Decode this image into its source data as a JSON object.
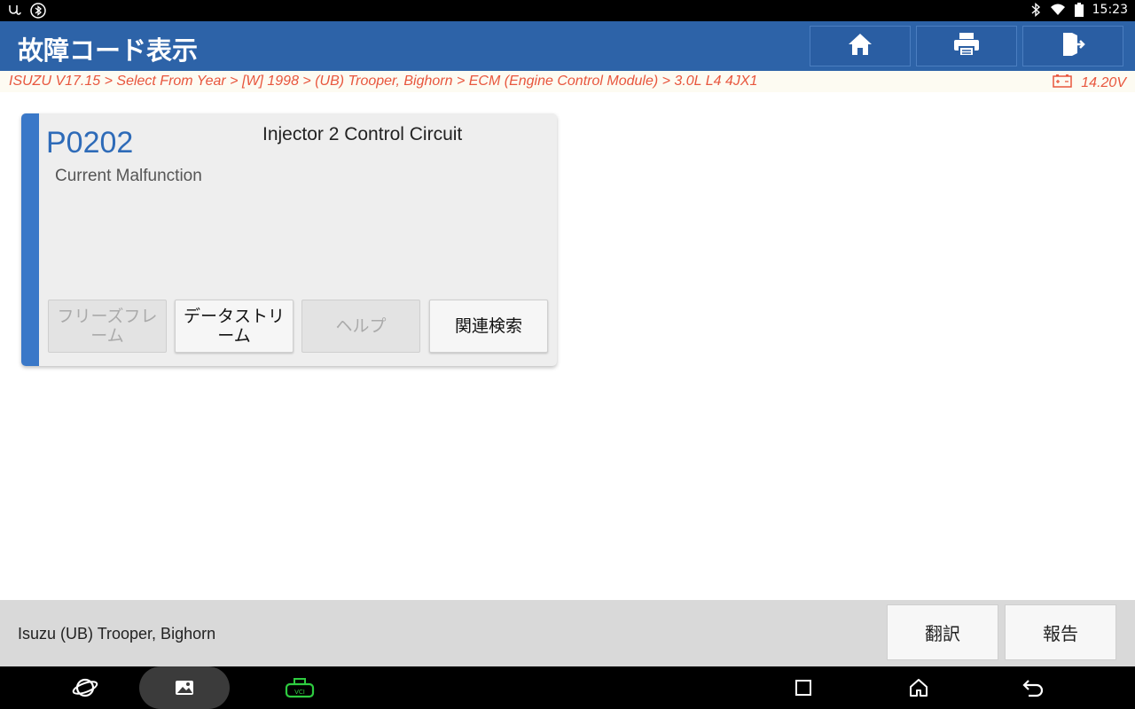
{
  "status_bar": {
    "time": "15:23",
    "left_icons": [
      "stethoscope-icon",
      "bluetooth-circle-icon"
    ],
    "right_icons": [
      "bluetooth-icon",
      "wifi-icon",
      "battery-icon"
    ]
  },
  "header": {
    "title": "故障コード表示",
    "buttons": [
      "home-icon",
      "print-icon",
      "exit-icon"
    ]
  },
  "breadcrumb": {
    "path": "ISUZU V17.15 > Select From Year > [W] 1998 > (UB) Trooper, Bighorn > ECM (Engine Control Module) > 3.0L L4 4JX1",
    "voltage": "14.20V"
  },
  "dtc": {
    "code": "P0202",
    "status": "Current Malfunction",
    "description": "Injector 2 Control Circuit",
    "buttons": [
      {
        "label": "フリーズフレーム",
        "enabled": false
      },
      {
        "label": "データストリーム",
        "enabled": true
      },
      {
        "label": "ヘルプ",
        "enabled": false
      },
      {
        "label": "関連検索",
        "enabled": true
      }
    ]
  },
  "footer": {
    "vehicle": "Isuzu (UB) Trooper, Bighorn",
    "translate_label": "翻訳",
    "report_label": "報告"
  },
  "navbar": {
    "icons": [
      "browser-icon",
      "gallery-icon",
      "vci-icon",
      "recent-apps-icon",
      "home-nav-icon",
      "back-icon"
    ],
    "vci_label": "VCI",
    "vci_color": "#2ecc40"
  },
  "colors": {
    "header_bg": "#2d63a8",
    "accent": "#3a78c8",
    "breadcrumb_text": "#e8563d"
  }
}
